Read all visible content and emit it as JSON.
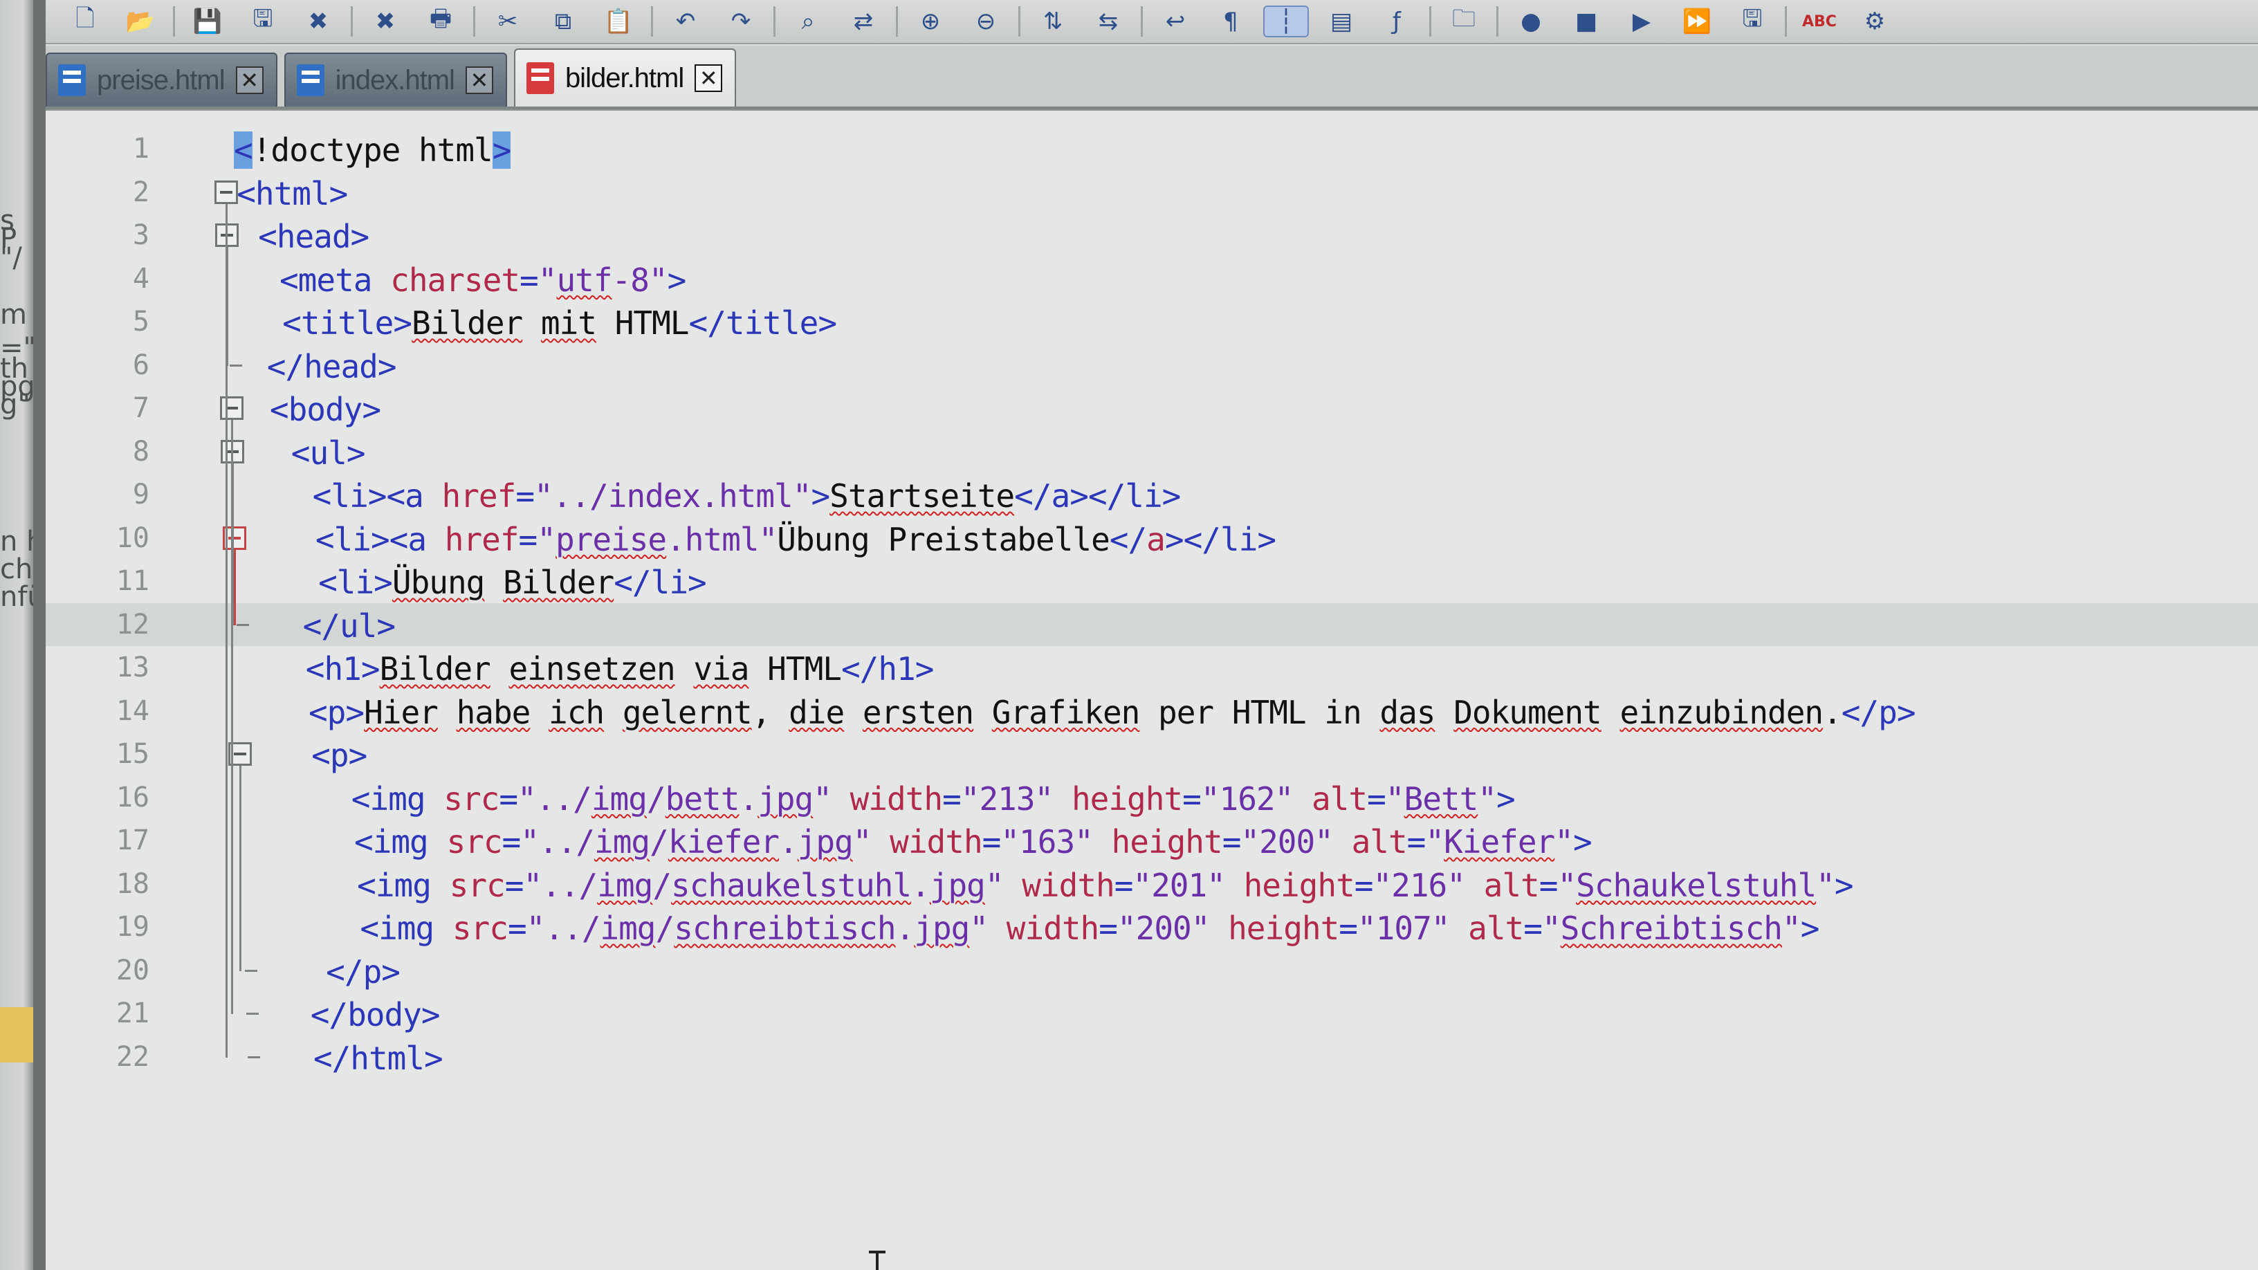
{
  "background_window": {
    "text_fragments": [
      "s",
      "P",
      "\"/",
      "m",
      "=\"",
      "th",
      "pg",
      "g\"",
      "n ha",
      "ch a",
      "nfüh"
    ]
  },
  "toolbar": {
    "icons": [
      "new-file-icon",
      "open-folder-icon",
      "save-icon",
      "save-all-icon",
      "close-file-icon",
      "close-all-icon",
      "print-icon",
      "cut-icon",
      "copy-icon",
      "paste-icon",
      "undo-icon",
      "redo-icon",
      "find-icon",
      "replace-icon",
      "zoom-in-icon",
      "zoom-out-icon",
      "sync-vertical-icon",
      "sync-horizontal-icon",
      "word-wrap-icon",
      "show-all-chars-icon",
      "indent-guide-icon",
      "doc-map-icon",
      "function-list-icon",
      "folder-workspace-icon",
      "record-macro-icon",
      "stop-macro-icon",
      "play-macro-icon",
      "run-macro-multiple-icon",
      "save-macro-icon",
      "spellcheck-icon",
      "plugin-icon"
    ],
    "glyphs": [
      "🗋",
      "📂",
      "💾",
      "🖫",
      "✖",
      "✖",
      "🖶",
      "✂",
      "⧉",
      "📋",
      "↶",
      "↷",
      "⌕",
      "⇄",
      "⊕",
      "⊖",
      "⇅",
      "⇆",
      "↩",
      "¶",
      "┆",
      "▤",
      "ƒ",
      "🗀",
      "●",
      "■",
      "▶",
      "⏩",
      "🖫",
      "ABC",
      "⚙"
    ]
  },
  "tabs": [
    {
      "label": "preise.html",
      "active": false
    },
    {
      "label": "index.html",
      "active": false
    },
    {
      "label": "bilder.html",
      "active": true
    }
  ],
  "tab_close_glyph": "✕",
  "editor": {
    "current_line": 12,
    "lines": [
      {
        "n": "1",
        "segments": [
          {
            "t": "<",
            "c": "t",
            "s": true
          },
          {
            "t": "!doctype html",
            "c": "x"
          },
          {
            "t": ">",
            "c": "t",
            "s": true
          }
        ]
      },
      {
        "n": "2",
        "segments": [
          {
            "t": "<html>",
            "c": "t"
          }
        ]
      },
      {
        "n": "3",
        "segments": [
          {
            "t": " <head>",
            "c": "t"
          }
        ]
      },
      {
        "n": "4",
        "segments": [
          {
            "t": "  <meta ",
            "c": "t"
          },
          {
            "t": "charset",
            "c": "a"
          },
          {
            "t": "=",
            "c": "t"
          },
          {
            "t": "\"",
            "c": "v"
          },
          {
            "t": "utf",
            "c": "v",
            "u": true
          },
          {
            "t": "-8\"",
            "c": "v"
          },
          {
            "t": ">",
            "c": "t"
          }
        ]
      },
      {
        "n": "5",
        "segments": [
          {
            "t": "  <title>",
            "c": "t"
          },
          {
            "t": "Bilder",
            "c": "x",
            "u": true
          },
          {
            "t": " ",
            "c": "x"
          },
          {
            "t": "mit",
            "c": "x",
            "u": true
          },
          {
            "t": " HTML",
            "c": "x"
          },
          {
            "t": "</title>",
            "c": "t"
          }
        ]
      },
      {
        "n": "6",
        "segments": [
          {
            "t": " </head>",
            "c": "t"
          }
        ]
      },
      {
        "n": "7",
        "segments": [
          {
            "t": " <body>",
            "c": "t"
          }
        ]
      },
      {
        "n": "8",
        "segments": [
          {
            "t": "  <ul>",
            "c": "t"
          }
        ]
      },
      {
        "n": "9",
        "segments": [
          {
            "t": "   <li><a ",
            "c": "t"
          },
          {
            "t": "href",
            "c": "a"
          },
          {
            "t": "=",
            "c": "t"
          },
          {
            "t": "\"../index.html\"",
            "c": "v"
          },
          {
            "t": ">",
            "c": "t"
          },
          {
            "t": "Startseite",
            "c": "x",
            "u": true
          },
          {
            "t": "</a></li>",
            "c": "t"
          }
        ]
      },
      {
        "n": "10",
        "segments": [
          {
            "t": "   <li><a ",
            "c": "t"
          },
          {
            "t": "href",
            "c": "a"
          },
          {
            "t": "=",
            "c": "t"
          },
          {
            "t": "\"",
            "c": "v"
          },
          {
            "t": "preise",
            "c": "v",
            "u": true
          },
          {
            "t": ".html\"",
            "c": "v"
          },
          {
            "t": "Übung Preistabelle",
            "c": "x"
          },
          {
            "t": "</",
            "c": "t"
          },
          {
            "t": "a",
            "c": "a"
          },
          {
            "t": "></li>",
            "c": "t"
          }
        ]
      },
      {
        "n": "11",
        "segments": [
          {
            "t": "   <li>",
            "c": "t"
          },
          {
            "t": "Übung",
            "c": "x",
            "u": true
          },
          {
            "t": " ",
            "c": "x"
          },
          {
            "t": "Bilder",
            "c": "x",
            "u": true
          },
          {
            "t": "</li>",
            "c": "t"
          }
        ]
      },
      {
        "n": "12",
        "segments": [
          {
            "t": "  </ul>",
            "c": "t"
          }
        ]
      },
      {
        "n": "13",
        "segments": [
          {
            "t": "  <h1>",
            "c": "t"
          },
          {
            "t": "Bilder",
            "c": "x",
            "u": true
          },
          {
            "t": " ",
            "c": "x"
          },
          {
            "t": "einsetzen",
            "c": "x",
            "u": true
          },
          {
            "t": " ",
            "c": "x"
          },
          {
            "t": "via",
            "c": "x",
            "u": true
          },
          {
            "t": " HTML",
            "c": "x"
          },
          {
            "t": "</h1>",
            "c": "t"
          }
        ]
      },
      {
        "n": "14",
        "segments": [
          {
            "t": "  <p>",
            "c": "t"
          },
          {
            "t": "Hier",
            "c": "x",
            "u": true
          },
          {
            "t": " ",
            "c": "x"
          },
          {
            "t": "habe",
            "c": "x",
            "u": true
          },
          {
            "t": " ",
            "c": "x"
          },
          {
            "t": "ich",
            "c": "x",
            "u": true
          },
          {
            "t": " ",
            "c": "x"
          },
          {
            "t": "gelernt",
            "c": "x",
            "u": true
          },
          {
            "t": ", ",
            "c": "x"
          },
          {
            "t": "die",
            "c": "x",
            "u": true
          },
          {
            "t": " ",
            "c": "x"
          },
          {
            "t": "ersten",
            "c": "x",
            "u": true
          },
          {
            "t": " ",
            "c": "x"
          },
          {
            "t": "Grafiken",
            "c": "x",
            "u": true
          },
          {
            "t": " per HTML ",
            "c": "x"
          },
          {
            "t": "in",
            "c": "x"
          },
          {
            "t": " ",
            "c": "x"
          },
          {
            "t": "das",
            "c": "x",
            "u": true
          },
          {
            "t": " ",
            "c": "x"
          },
          {
            "t": "Dokument",
            "c": "x",
            "u": true
          },
          {
            "t": " ",
            "c": "x"
          },
          {
            "t": "einzubinden",
            "c": "x",
            "u": true
          },
          {
            "t": ".",
            "c": "x"
          },
          {
            "t": "</p>",
            "c": "t"
          }
        ]
      },
      {
        "n": "15",
        "segments": [
          {
            "t": "  <p>",
            "c": "t"
          }
        ]
      },
      {
        "n": "16",
        "segments": [
          {
            "t": "    <img ",
            "c": "t"
          },
          {
            "t": "src",
            "c": "a"
          },
          {
            "t": "=",
            "c": "t"
          },
          {
            "t": "\"../",
            "c": "v"
          },
          {
            "t": "img",
            "c": "v",
            "u": true
          },
          {
            "t": "/",
            "c": "v"
          },
          {
            "t": "bett",
            "c": "v",
            "u": true
          },
          {
            "t": ".",
            "c": "v"
          },
          {
            "t": "jpg",
            "c": "v",
            "u": true
          },
          {
            "t": "\" ",
            "c": "v"
          },
          {
            "t": "width",
            "c": "a"
          },
          {
            "t": "=",
            "c": "t"
          },
          {
            "t": "\"213\" ",
            "c": "v"
          },
          {
            "t": "height",
            "c": "a"
          },
          {
            "t": "=",
            "c": "t"
          },
          {
            "t": "\"162\" ",
            "c": "v"
          },
          {
            "t": "alt",
            "c": "a"
          },
          {
            "t": "=",
            "c": "t"
          },
          {
            "t": "\"",
            "c": "v"
          },
          {
            "t": "Bett",
            "c": "v",
            "u": true
          },
          {
            "t": "\"",
            "c": "v"
          },
          {
            "t": ">",
            "c": "t"
          }
        ]
      },
      {
        "n": "17",
        "segments": [
          {
            "t": "    <img ",
            "c": "t"
          },
          {
            "t": "src",
            "c": "a"
          },
          {
            "t": "=",
            "c": "t"
          },
          {
            "t": "\"../",
            "c": "v"
          },
          {
            "t": "img",
            "c": "v",
            "u": true
          },
          {
            "t": "/",
            "c": "v"
          },
          {
            "t": "kiefer",
            "c": "v",
            "u": true
          },
          {
            "t": ".",
            "c": "v"
          },
          {
            "t": "jpg",
            "c": "v",
            "u": true
          },
          {
            "t": "\" ",
            "c": "v"
          },
          {
            "t": "width",
            "c": "a"
          },
          {
            "t": "=",
            "c": "t"
          },
          {
            "t": "\"163\" ",
            "c": "v"
          },
          {
            "t": "height",
            "c": "a"
          },
          {
            "t": "=",
            "c": "t"
          },
          {
            "t": "\"200\" ",
            "c": "v"
          },
          {
            "t": "alt",
            "c": "a"
          },
          {
            "t": "=",
            "c": "t"
          },
          {
            "t": "\"",
            "c": "v"
          },
          {
            "t": "Kiefer",
            "c": "v",
            "u": true
          },
          {
            "t": "\"",
            "c": "v"
          },
          {
            "t": ">",
            "c": "t"
          }
        ]
      },
      {
        "n": "18",
        "segments": [
          {
            "t": "    <img ",
            "c": "t"
          },
          {
            "t": "src",
            "c": "a"
          },
          {
            "t": "=",
            "c": "t"
          },
          {
            "t": "\"../",
            "c": "v"
          },
          {
            "t": "img",
            "c": "v",
            "u": true
          },
          {
            "t": "/",
            "c": "v"
          },
          {
            "t": "schaukelstuhl",
            "c": "v",
            "u": true
          },
          {
            "t": ".",
            "c": "v"
          },
          {
            "t": "jpg",
            "c": "v",
            "u": true
          },
          {
            "t": "\" ",
            "c": "v"
          },
          {
            "t": "width",
            "c": "a"
          },
          {
            "t": "=",
            "c": "t"
          },
          {
            "t": "\"201\" ",
            "c": "v"
          },
          {
            "t": "height",
            "c": "a"
          },
          {
            "t": "=",
            "c": "t"
          },
          {
            "t": "\"216\" ",
            "c": "v"
          },
          {
            "t": "alt",
            "c": "a"
          },
          {
            "t": "=",
            "c": "t"
          },
          {
            "t": "\"",
            "c": "v"
          },
          {
            "t": "Schaukelstuhl",
            "c": "v",
            "u": true
          },
          {
            "t": "\"",
            "c": "v"
          },
          {
            "t": ">",
            "c": "t"
          }
        ]
      },
      {
        "n": "19",
        "segments": [
          {
            "t": "    <img ",
            "c": "t"
          },
          {
            "t": "src",
            "c": "a"
          },
          {
            "t": "=",
            "c": "t"
          },
          {
            "t": "\"../",
            "c": "v"
          },
          {
            "t": "img",
            "c": "v",
            "u": true
          },
          {
            "t": "/",
            "c": "v"
          },
          {
            "t": "schreibtisch",
            "c": "v",
            "u": true
          },
          {
            "t": ".",
            "c": "v"
          },
          {
            "t": "jpg",
            "c": "v",
            "u": true
          },
          {
            "t": "\" ",
            "c": "v"
          },
          {
            "t": "width",
            "c": "a"
          },
          {
            "t": "=",
            "c": "t"
          },
          {
            "t": "\"200\" ",
            "c": "v"
          },
          {
            "t": "height",
            "c": "a"
          },
          {
            "t": "=",
            "c": "t"
          },
          {
            "t": "\"107\" ",
            "c": "v"
          },
          {
            "t": "alt",
            "c": "a"
          },
          {
            "t": "=",
            "c": "t"
          },
          {
            "t": "\"",
            "c": "v"
          },
          {
            "t": "Schreibtisch",
            "c": "v",
            "u": true
          },
          {
            "t": "\"",
            "c": "v"
          },
          {
            "t": ">",
            "c": "t"
          }
        ]
      },
      {
        "n": "20",
        "segments": [
          {
            "t": "  </p>",
            "c": "t"
          }
        ]
      },
      {
        "n": "21",
        "segments": [
          {
            "t": " </body>",
            "c": "t"
          }
        ]
      },
      {
        "n": "22",
        "segments": [
          {
            "t": " </html>",
            "c": "t"
          }
        ]
      }
    ]
  },
  "colors": {
    "tag": "#2b37b8",
    "attribute": "#b0284a",
    "value": "#6b2fa8",
    "text": "#111111",
    "spell_underline": "#d02020",
    "active_tab_icon": "#d73a3a",
    "inactive_tab_icon": "#2f6fc4"
  }
}
